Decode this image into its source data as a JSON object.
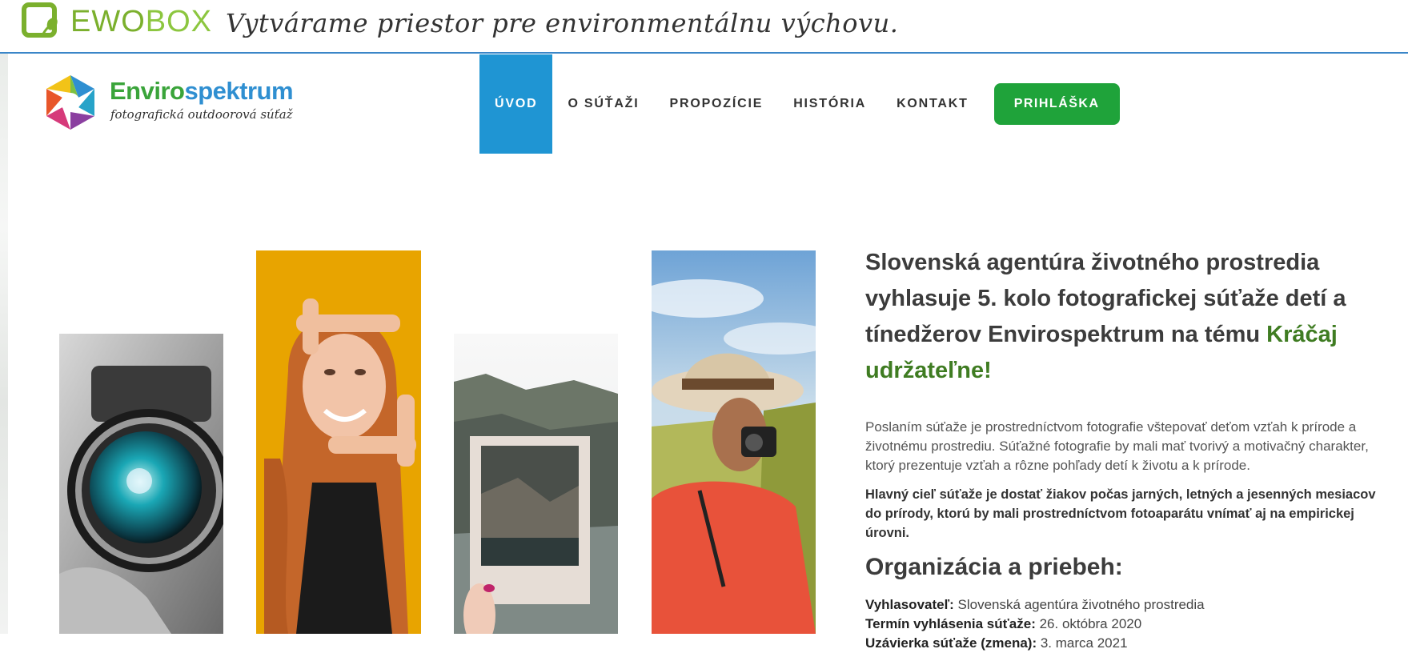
{
  "topbar": {
    "logo_part1": "EWO",
    "logo_part2": "BOX",
    "tagline": "Vytvárame priestor pre environmentálnu výchovu."
  },
  "site_logo": {
    "brand_part1": "Enviro",
    "brand_part2": "spektrum",
    "subtitle": "fotografická outdoorová súťaž"
  },
  "nav": {
    "items": [
      {
        "label": "ÚVOD",
        "active": true
      },
      {
        "label": "O SÚŤAŽI"
      },
      {
        "label": "PROPOZÍCIE"
      },
      {
        "label": "HISTÓRIA"
      },
      {
        "label": "KONTAKT"
      }
    ],
    "cta_label": "PRIHLÁŠKA"
  },
  "photos": [
    {
      "icon": "camera-lens-photo"
    },
    {
      "icon": "girl-framing-photo"
    },
    {
      "icon": "polaroid-landscape-photo"
    },
    {
      "icon": "woman-with-camera-photo"
    }
  ],
  "main": {
    "headline_text": "Slovenská agentúra životného prostredia vyhlasuje 5. kolo fotografickej súťaže detí a tínedžerov Envirospektrum na tému ",
    "headline_accent": "Kráčaj udržateľne!",
    "intro": "Poslaním súťaže je prostredníctvom fotografie vštepovať deťom vzťah k prírode a životnému prostrediu. Súťažné fotografie by mali mať tvorivý a motivačný charakter, ktorý prezentuje vzťah a rôzne pohľady detí k životu a k prírode.",
    "goal": "Hlavný cieľ súťaže je dostať žiakov počas jarných, letných a jesenných mesiacov do prírody, ktorú by mali prostredníctvom fotoaparátu vnímať aj na empirickej úrovni.",
    "org_title": "Organizácia a priebeh:",
    "facts": [
      {
        "label": "Vyhlasovateľ:",
        "value": " Slovenská agentúra životného prostredia"
      },
      {
        "label": "Termín vyhlásenia súťaže:",
        "value": " 26. októbra 2020"
      },
      {
        "label": "Uzávierka súťaže (zmena):",
        "value": " 3. marca 2021"
      }
    ]
  },
  "colors": {
    "nav_active": "#1f95d3",
    "cta": "#1fa33a",
    "accent_green": "#3f7c22",
    "brand_blue": "#2f8fd1"
  }
}
